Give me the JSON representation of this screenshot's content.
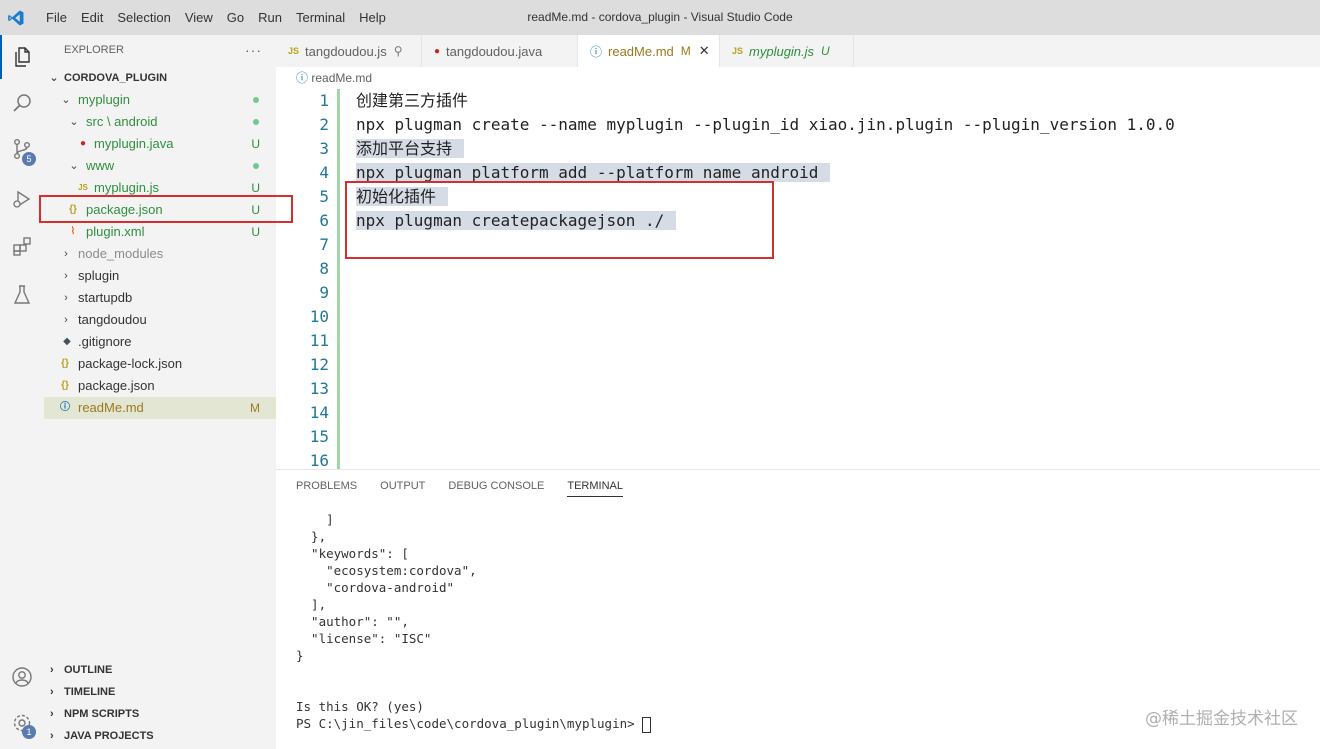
{
  "titlebar": {
    "menu": [
      "File",
      "Edit",
      "Selection",
      "View",
      "Go",
      "Run",
      "Terminal",
      "Help"
    ],
    "title": "readMe.md - cordova_plugin - Visual Studio Code"
  },
  "activity": {
    "source_control_badge": "5",
    "settings_badge": "1"
  },
  "sidebar": {
    "header": "EXPLORER",
    "more": "···",
    "root": "CORDOVA_PLUGIN",
    "items": [
      {
        "label": "myplugin",
        "status": ""
      },
      {
        "label": "src \\ android",
        "status": ""
      },
      {
        "label": "myplugin.java",
        "status": "U"
      },
      {
        "label": "www",
        "status": ""
      },
      {
        "label": "myplugin.js",
        "status": "U"
      },
      {
        "label": "package.json",
        "status": "U"
      },
      {
        "label": "plugin.xml",
        "status": "U"
      },
      {
        "label": "node_modules",
        "status": ""
      },
      {
        "label": "splugin",
        "status": ""
      },
      {
        "label": "startupdb",
        "status": ""
      },
      {
        "label": "tangdoudou",
        "status": ""
      },
      {
        "label": ".gitignore",
        "status": ""
      },
      {
        "label": "package-lock.json",
        "status": ""
      },
      {
        "label": "package.json",
        "status": ""
      },
      {
        "label": "readMe.md",
        "status": "M"
      }
    ],
    "panels": [
      "OUTLINE",
      "TIMELINE",
      "NPM SCRIPTS",
      "JAVA PROJECTS"
    ]
  },
  "tabs": [
    {
      "label": "tangdoudou.js",
      "suffix": "⚲"
    },
    {
      "label": "tangdoudou.java",
      "suffix": ""
    },
    {
      "label": "readMe.md",
      "suffix": "M"
    },
    {
      "label": "myplugin.js",
      "suffix": "U"
    }
  ],
  "breadcrumb": "readMe.md",
  "editor": {
    "line_numbers": [
      "1",
      "2",
      "3",
      "4",
      "5",
      "6",
      "7",
      "8",
      "9",
      "10",
      "11",
      "12",
      "13",
      "14",
      "15",
      "16"
    ],
    "lines": [
      "创建第三方插件",
      "npx plugman create --name myplugin --plugin_id xiao.jin.plugin --plugin_version 1.0.0",
      "添加平台支持",
      "npx plugman platform add --platform_name android",
      "初始化插件",
      "npx plugman createpackagejson ./"
    ]
  },
  "panel": {
    "tabs": [
      "PROBLEMS",
      "OUTPUT",
      "DEBUG CONSOLE",
      "TERMINAL"
    ],
    "terminal_lines": [
      "    ]",
      "  },",
      "  \"keywords\": [",
      "    \"ecosystem:cordova\",",
      "    \"cordova-android\"",
      "  ],",
      "  \"author\": \"\",",
      "  \"license\": \"ISC\"",
      "}",
      "",
      "",
      "Is this OK? (yes)"
    ],
    "prompt": "PS C:\\jin_files\\code\\cordova_plugin\\myplugin> "
  },
  "watermark": "@稀土掘金技术社区",
  "colors": {
    "accent": "#005fb8",
    "annotation": "#d32f2f",
    "untracked": "#2f8f3f",
    "modified": "#9b7a1f"
  }
}
